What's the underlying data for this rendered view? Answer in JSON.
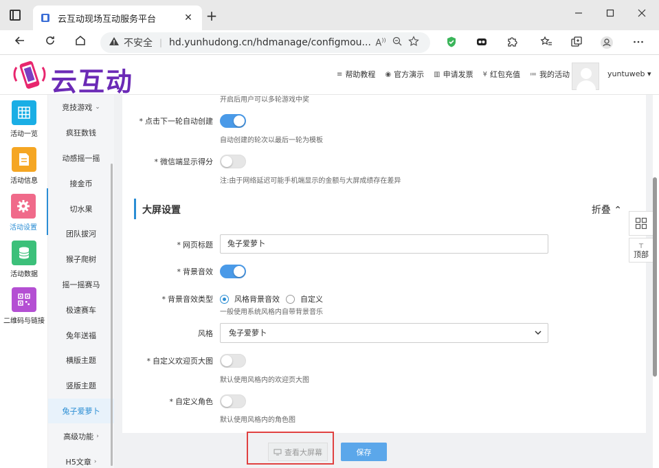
{
  "browser": {
    "tab_title": "云互动现场互动服务平台",
    "tab_close": "✕",
    "new_tab": "+",
    "insecure_label": "不安全",
    "url": "hd.yunhudong.cn/hdmanage/configmou...",
    "url_sep": "|"
  },
  "app": {
    "logo_text": "云互动",
    "nav": [
      {
        "glyph": "≡",
        "label": "帮助教程"
      },
      {
        "glyph": "◉",
        "label": "官方演示"
      },
      {
        "glyph": "▥",
        "label": "申请发票"
      },
      {
        "glyph": "¥",
        "label": "红包充值"
      },
      {
        "glyph": "≔",
        "label": "我的活动"
      }
    ],
    "username": "yuntuweb ▾"
  },
  "sidebar": {
    "items": [
      {
        "label": "活动一览",
        "color": "#1aaee5",
        "icon": "grid-icon"
      },
      {
        "label": "活动信息",
        "color": "#f5a623",
        "icon": "document-icon"
      },
      {
        "label": "活动设置",
        "color": "#f06a8a",
        "icon": "gear-icon"
      },
      {
        "label": "活动数据",
        "color": "#3cc07a",
        "icon": "database-icon"
      },
      {
        "label": "二维码与链接",
        "color": "#b44fd3",
        "icon": "qrcode-icon"
      }
    ]
  },
  "submenu": {
    "items": [
      "竞技游戏",
      "疯狂数钱",
      "动感摇一摇",
      "接金币",
      "切水果",
      "团队拔河",
      "猴子爬树",
      "摇一摇赛马",
      "极速赛车",
      "兔年送福",
      "横版主题",
      "竖版主题",
      "兔子爱萝卜",
      "高级功能",
      "H5文章"
    ],
    "chev": "⌄",
    "chev_right": "›"
  },
  "form": {
    "top_hint": "开启后用户可以多轮游戏中奖",
    "auto_next_label": "点击下一轮自动创建",
    "auto_next_hint": "自动创建的轮次以最后一轮为模板",
    "wechat_score_label": "微信端显示得分",
    "wechat_score_hint": "注:由于网络延迟可能手机端显示的金额与大屏成绩存在差异",
    "section_title": "大屏设置",
    "fold_label": "折叠 ⌃",
    "page_title_label": "网页标题",
    "page_title_value": "兔子爱萝卜",
    "bg_sound_label": "背景音效",
    "bg_sound_type_label": "背景音效类型",
    "radio_style": "风格背景音效",
    "radio_custom": "自定义",
    "bg_sound_hint": "一般使用系统风格内自带背景音乐",
    "style_label": "风格",
    "style_value": "兔子爱萝卜",
    "welcome_label": "自定义欢迎页大图",
    "welcome_hint": "默认使用风格内的欢迎页大图",
    "role_label": "自定义角色",
    "role_hint": "默认使用风格内的角色图",
    "star": "*"
  },
  "float": {
    "top_label": "顶部",
    "top_arrow": "⊤"
  },
  "actions": {
    "view_label": "查看大屏幕",
    "save_label": "保存"
  }
}
